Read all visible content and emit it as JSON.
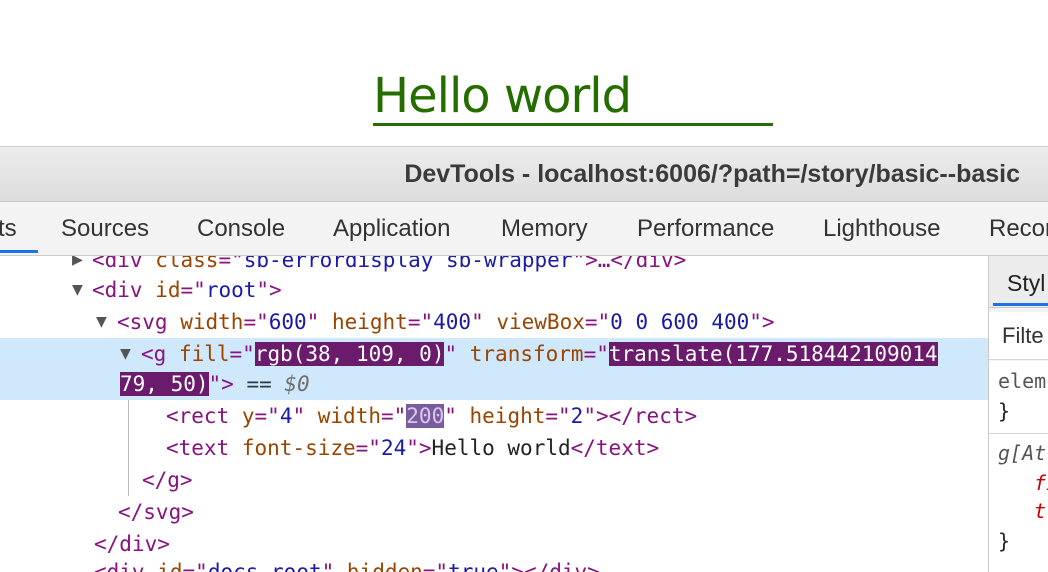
{
  "preview": {
    "hello_text": "Hello world",
    "text_color": "#266d00"
  },
  "titlebar": {
    "title": "DevTools - localhost:6006/?path=/story/basic--basic"
  },
  "tabs": [
    {
      "label": "ts",
      "active": true
    },
    {
      "label": "Sources"
    },
    {
      "label": "Console"
    },
    {
      "label": "Application"
    },
    {
      "label": "Memory"
    },
    {
      "label": "Performance"
    },
    {
      "label": "Lighthouse"
    },
    {
      "label": "Recor"
    }
  ],
  "dom_tree": {
    "line0": {
      "open": "<div ",
      "attr1": "class",
      "eq": "=\"",
      "val1": "sb-errordisplay sb-wrapper",
      "close": "\">…</div>"
    },
    "line1": {
      "tag_open": "<div ",
      "attr": "id",
      "val": "root",
      "tag_close": ">"
    },
    "line2": {
      "tag_open": "<svg ",
      "a1": "width",
      "v1": "600",
      "a2": "height",
      "v2": "400",
      "a3": "viewBox",
      "v3": "0 0 600 400",
      "tag_close": ">"
    },
    "line3": {
      "tag_open": "<g ",
      "a1": "fill",
      "v1": "rgb(38, 109, 0)",
      "a2": "transform",
      "v2a": "translate(177.518442109014"
    },
    "line4": {
      "v2b": "79, 50)",
      "tag_close": ">",
      "eq_marker": " == ",
      "dollar": "$0"
    },
    "line5": {
      "tag_open": "<rect ",
      "a1": "y",
      "v1": "4",
      "a2": "width",
      "v2": "200",
      "a3": "height",
      "v3": "2",
      "tag_close": "></rect>"
    },
    "line6": {
      "tag_open": "<text ",
      "a1": "font-size",
      "v1": "24",
      "text": "Hello world",
      "tag_close": "</text>"
    },
    "line7": {
      "tag": "</g>"
    },
    "line8": {
      "tag": "</svg>"
    },
    "line9": {
      "tag": "</div>"
    },
    "line10": {
      "open": "<div ",
      "a1": "id",
      "v1": "docs-root",
      "a2": "hidden",
      "v2": "true",
      "close": "></div>"
    }
  },
  "styles": {
    "tab_label": "Styl",
    "filter_placeholder": "Filte",
    "rule1_selector": "elem",
    "rule1_close": "}",
    "rule2_selector": "g[At",
    "rule2_prop1": "fi",
    "rule2_prop2": "tr",
    "rule2_close": "}"
  },
  "colors": {
    "accent": "#1a73e8",
    "selection": "#cfe8fc",
    "highlight": "#6b1b6b"
  }
}
